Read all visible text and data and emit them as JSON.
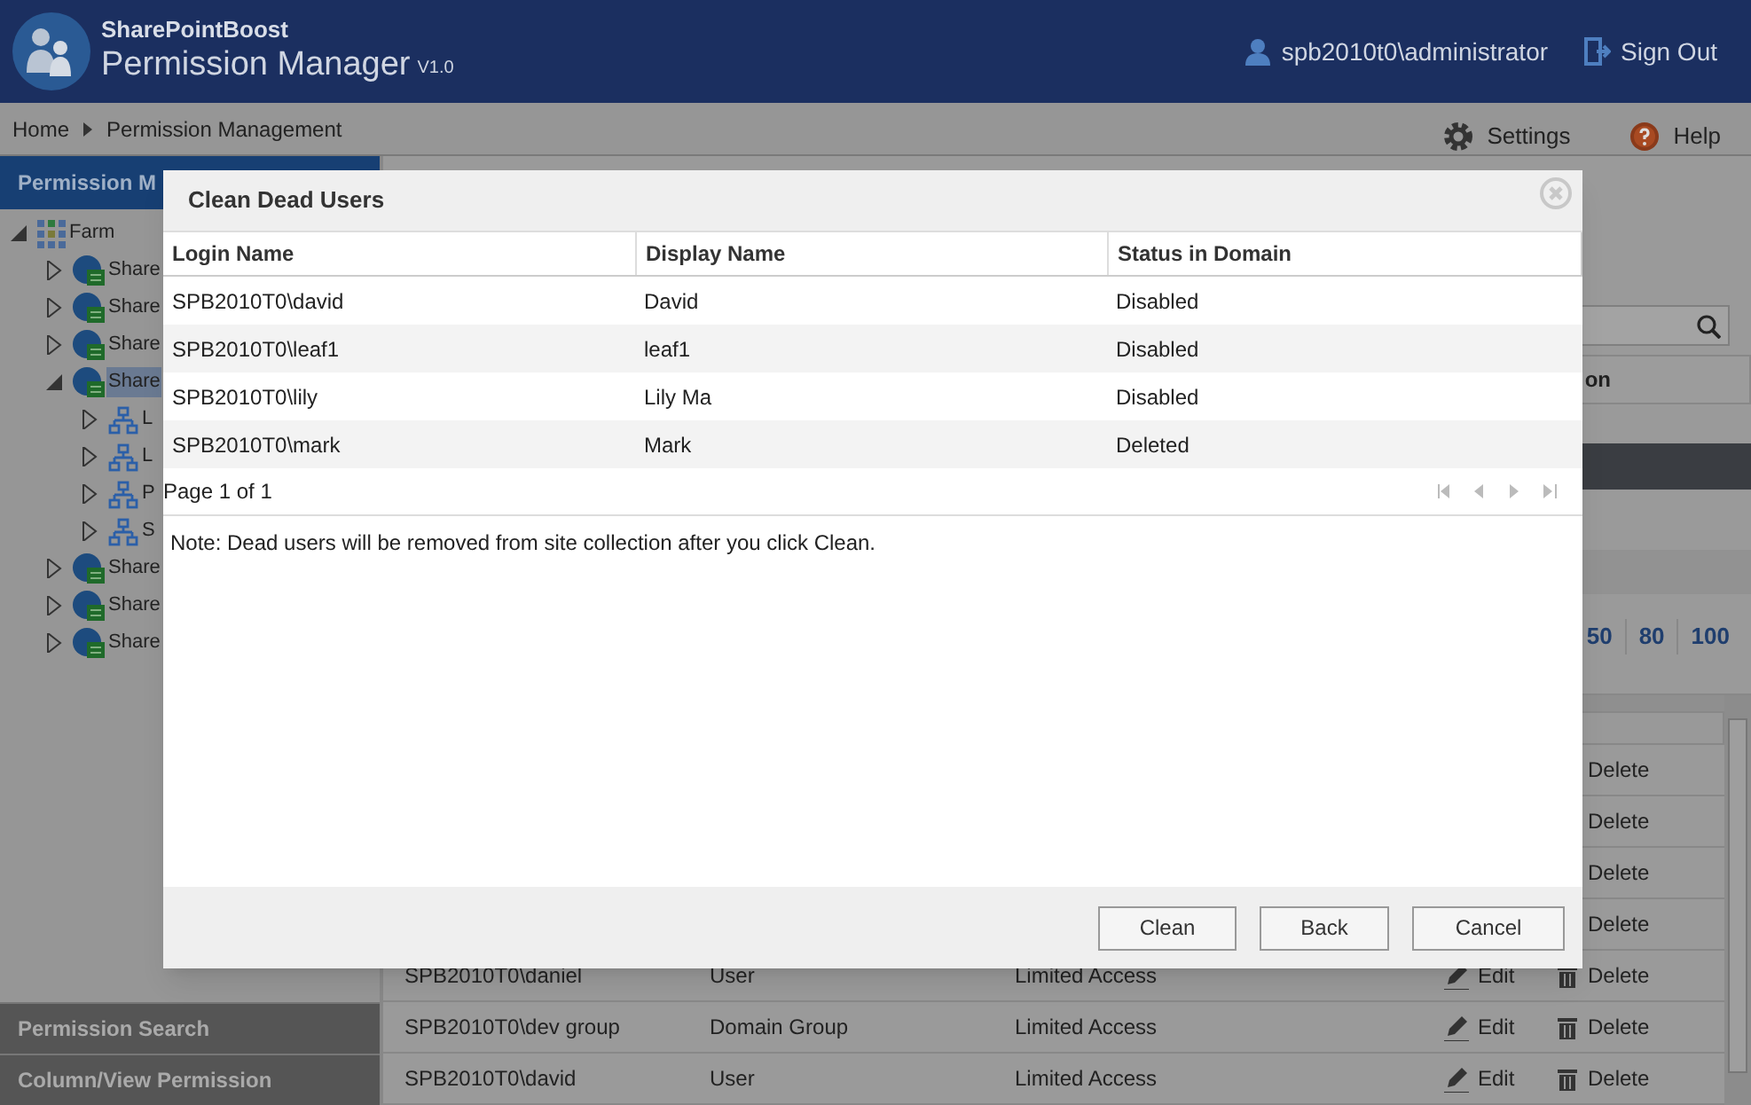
{
  "header": {
    "brand": "SharePointBoost",
    "app_title": "Permission Manager",
    "version": "V1.0",
    "user": "spb2010t0\\administrator",
    "sign_out": "Sign Out"
  },
  "breadcrumb": [
    "Home",
    "Permission Management"
  ],
  "toolbar": {
    "settings": "Settings",
    "help": "Help"
  },
  "sidebar": {
    "title": "Permission M",
    "tree": [
      {
        "label": "Farm",
        "kind": "farm",
        "expanded": true,
        "selected": false,
        "children": [
          {
            "label": "Share",
            "kind": "site",
            "expanded": false,
            "selected": false
          },
          {
            "label": "Share",
            "kind": "site",
            "expanded": false,
            "selected": false
          },
          {
            "label": "Share",
            "kind": "site",
            "expanded": false,
            "selected": false
          },
          {
            "label": "Share",
            "kind": "site",
            "expanded": true,
            "selected": true,
            "children": [
              {
                "label": "L",
                "kind": "web",
                "expanded": false,
                "selected": false
              },
              {
                "label": "L",
                "kind": "web",
                "expanded": false,
                "selected": false
              },
              {
                "label": "P",
                "kind": "web",
                "expanded": false,
                "selected": false
              },
              {
                "label": "S",
                "kind": "web",
                "expanded": false,
                "selected": false
              }
            ]
          },
          {
            "label": "Share",
            "kind": "site",
            "expanded": false,
            "selected": false
          },
          {
            "label": "Share",
            "kind": "site",
            "expanded": false,
            "selected": false
          },
          {
            "label": "Share",
            "kind": "site",
            "expanded": false,
            "selected": false
          }
        ]
      }
    ],
    "panels": [
      "Permission Search",
      "Column/View Permission"
    ]
  },
  "content": {
    "column_header": "on",
    "page_sizes": [
      "50",
      "80",
      "100"
    ],
    "rows": [
      {
        "delete": "Delete"
      },
      {
        "delete": "Delete"
      },
      {
        "delete": "Delete"
      },
      {
        "delete": "Delete"
      },
      {
        "login": "SPB2010T0\\daniel",
        "type": "User",
        "permission": "Limited Access",
        "edit": "Edit",
        "delete": "Delete"
      },
      {
        "login": "SPB2010T0\\dev group",
        "type": "Domain Group",
        "permission": "Limited Access",
        "edit": "Edit",
        "delete": "Delete"
      },
      {
        "login": "SPB2010T0\\david",
        "type": "User",
        "permission": "Limited Access",
        "edit": "Edit",
        "delete": "Delete"
      }
    ]
  },
  "dialog": {
    "title": "Clean Dead Users",
    "columns": [
      "Login Name",
      "Display Name",
      "Status in Domain"
    ],
    "rows": [
      [
        "SPB2010T0\\david",
        "David",
        "Disabled"
      ],
      [
        "SPB2010T0\\leaf1",
        "leaf1",
        "Disabled"
      ],
      [
        "SPB2010T0\\lily",
        "Lily Ma",
        "Disabled"
      ],
      [
        "SPB2010T0\\mark",
        "Mark",
        "Deleted"
      ]
    ],
    "pager": "Page 1 of 1",
    "note": "Note: Dead users will be removed from site collection after you click Clean.",
    "buttons": [
      "Clean",
      "Back",
      "Cancel"
    ]
  }
}
